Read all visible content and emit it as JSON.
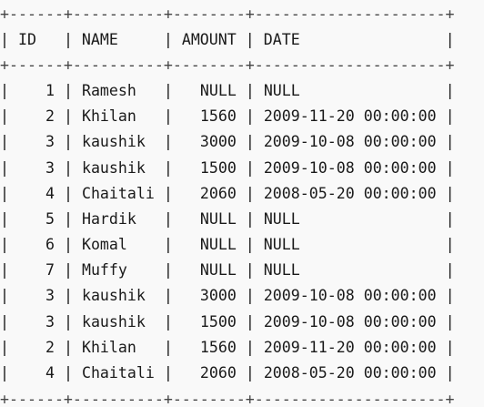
{
  "table": {
    "headers": [
      "ID",
      "NAME",
      "AMOUNT",
      "DATE"
    ],
    "rows": [
      [
        "1",
        "Ramesh",
        "NULL",
        "NULL"
      ],
      [
        "2",
        "Khilan",
        "1560",
        "2009-11-20 00:00:00"
      ],
      [
        "3",
        "kaushik",
        "3000",
        "2009-10-08 00:00:00"
      ],
      [
        "3",
        "kaushik",
        "1500",
        "2009-10-08 00:00:00"
      ],
      [
        "4",
        "Chaitali",
        "2060",
        "2008-05-20 00:00:00"
      ],
      [
        "5",
        "Hardik",
        "NULL",
        "NULL"
      ],
      [
        "6",
        "Komal",
        "NULL",
        "NULL"
      ],
      [
        "7",
        "Muffy",
        "NULL",
        "NULL"
      ],
      [
        "3",
        "kaushik",
        "3000",
        "2009-10-08 00:00:00"
      ],
      [
        "3",
        "kaushik",
        "1500",
        "2009-10-08 00:00:00"
      ],
      [
        "2",
        "Khilan",
        "1560",
        "2009-11-20 00:00:00"
      ],
      [
        "4",
        "Chaitali",
        "2060",
        "2008-05-20 00:00:00"
      ]
    ]
  }
}
